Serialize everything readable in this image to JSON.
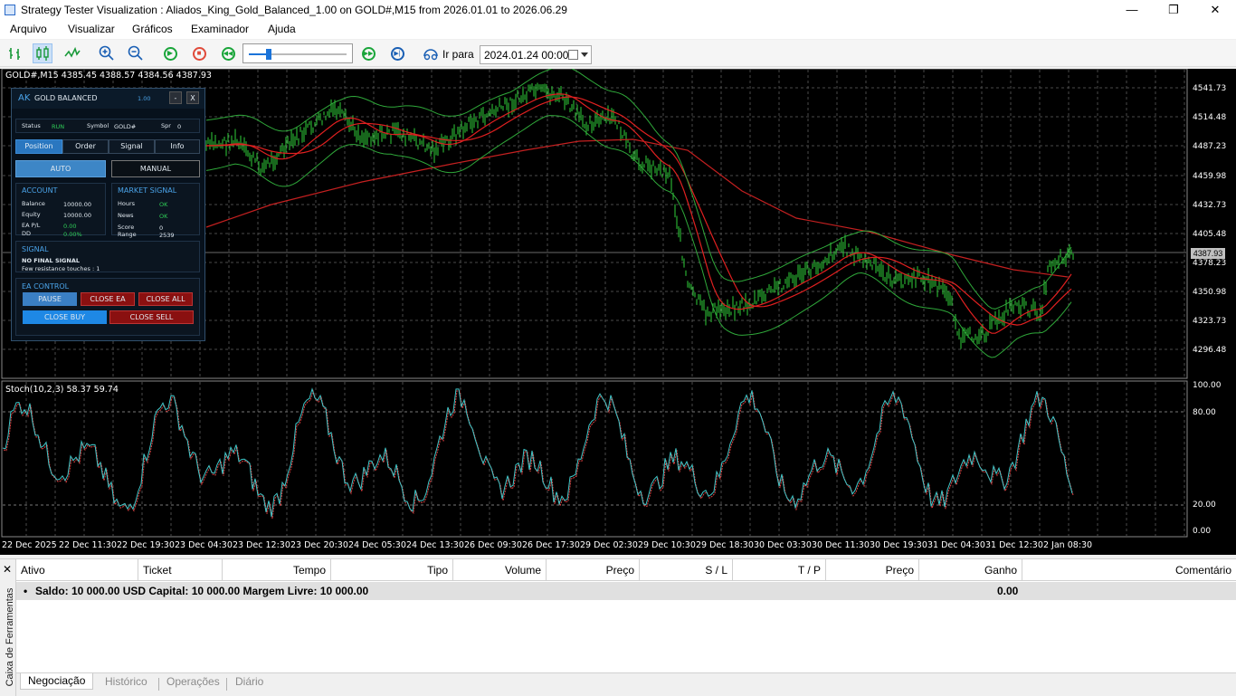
{
  "window": {
    "title": "Strategy Tester Visualization : Aliados_King_Gold_Balanced_1.00 on GOLD#,M15 from 2026.01.01 to 2026.06.29",
    "minimize": "—",
    "maximize": "❐",
    "close": "✕"
  },
  "menu": [
    "Arquivo",
    "Visualizar",
    "Gráficos",
    "Examinador",
    "Ajuda"
  ],
  "toolbar": {
    "goto_label": "Ir para",
    "goto_date": "2024.01.24 00:00",
    "speed": 0.2
  },
  "chart": {
    "symbol_info": "GOLD#,M15  4385.45 4388.57 4384.56 4387.93",
    "current_price": "4387.93",
    "price_labels": [
      "4541.73",
      "4514.48",
      "4487.23",
      "4459.98",
      "4432.73",
      "4405.48",
      "4378.23",
      "4350.98",
      "4323.73",
      "4296.48"
    ],
    "stoch_info": "Stoch(10,2,3) 58.37 59.74",
    "stoch_labels": [
      "100.00",
      "80.00",
      "20.00",
      "0.00"
    ],
    "time_labels": [
      "22 Dec 2025",
      "22 Dec 11:30",
      "22 Dec 19:30",
      "23 Dec 04:30",
      "23 Dec 12:30",
      "23 Dec 20:30",
      "24 Dec 05:30",
      "24 Dec 13:30",
      "26 Dec 09:30",
      "26 Dec 17:30",
      "29 Dec 02:30",
      "29 Dec 10:30",
      "29 Dec 18:30",
      "30 Dec 03:30",
      "30 Dec 11:30",
      "30 Dec 19:30",
      "31 Dec 04:30",
      "31 Dec 12:30",
      "2 Jan 08:30"
    ],
    "colors": {
      "candles": "#2fd03a",
      "ma_fast": "#e02020",
      "ma_slow": "#c42020",
      "bands": "#2fa83a",
      "stoch_main": "#3fc7c9",
      "stoch_signal": "#e04040",
      "grid": "#4a4a4a"
    }
  },
  "ea_panel": {
    "logo": "AK",
    "title": "GOLD BALANCED",
    "version": "1.00",
    "min_btn": "-",
    "close_btn": "X",
    "status_label": "Status",
    "status_value": "RUN",
    "symbol_label": "Symbol",
    "symbol_value": "GOLD#",
    "spr_label": "Spr",
    "spr_value": "0",
    "tabs": [
      "Position",
      "Order",
      "Signal",
      "Info"
    ],
    "mode_auto": "AUTO",
    "mode_manual": "MANUAL",
    "account": {
      "header": "ACCOUNT",
      "rows": [
        {
          "label": "Balance",
          "value": "10000.00"
        },
        {
          "label": "Equity",
          "value": "10000.00"
        },
        {
          "label": "EA P/L",
          "value": "0.00"
        },
        {
          "label": "DD",
          "value": "0.00%"
        }
      ]
    },
    "market": {
      "header": "MARKET SIGNAL",
      "rows": [
        {
          "label": "Hours",
          "value": "OK"
        },
        {
          "label": "News",
          "value": "OK"
        },
        {
          "label": "Score",
          "value": "0"
        },
        {
          "label": "Range",
          "value": "2539"
        }
      ]
    },
    "signal": {
      "header": "SIGNAL",
      "line1": "NO FINAL SIGNAL",
      "line2": "Few resistance touches : 1"
    },
    "control": {
      "header": "EA CONTROL",
      "pause": "PAUSE",
      "close_ea": "CLOSE EA",
      "close_all": "CLOSE ALL",
      "close_buy": "CLOSE BUY",
      "close_sell": "CLOSE SELL"
    }
  },
  "terminal": {
    "side_label": "Caixa de Ferramentas",
    "close": "✕",
    "columns": [
      "Ativo",
      "Ticket",
      "Tempo",
      "Tipo",
      "Volume",
      "Preço",
      "S / L",
      "T / P",
      "Preço",
      "Ganho",
      "Comentário"
    ],
    "balance_line": "Saldo: 10 000.00 USD  Capital: 10 000.00  Margem Livre: 10 000.00",
    "profit": "0.00",
    "tabs": [
      "Negociação",
      "Histórico",
      "Operações",
      "Diário"
    ]
  }
}
